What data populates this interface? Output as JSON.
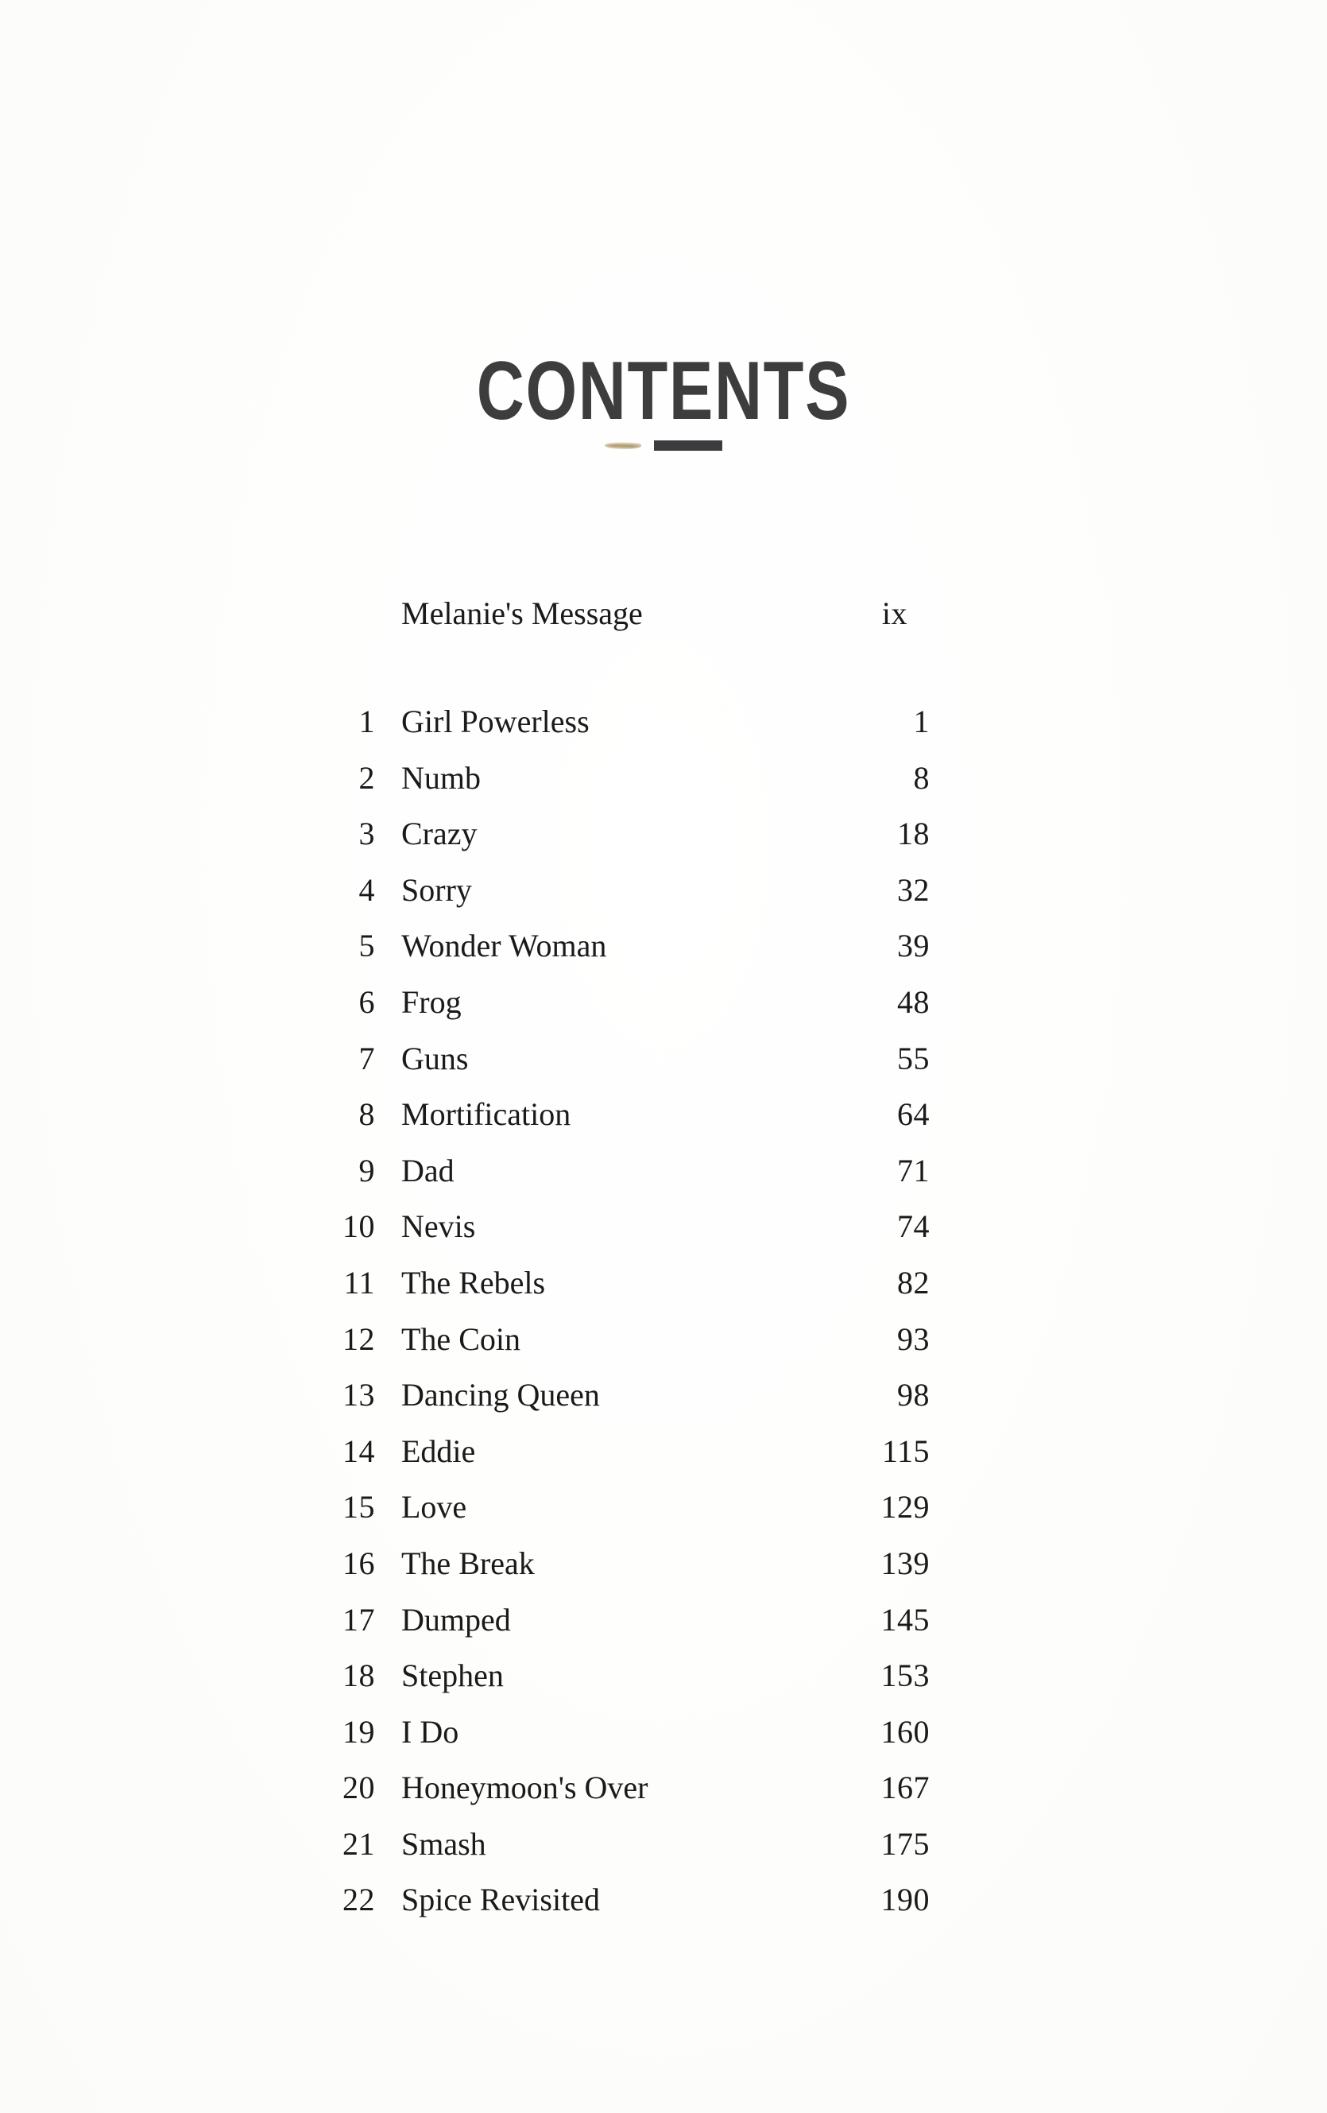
{
  "page": {
    "heading": "CONTENTS",
    "ornament": "horizontal-rule-ornament",
    "background_color": "#fdfdfd",
    "heading_color": "#3d3d3d",
    "text_color": "#1a1a1a",
    "ornament_rule_color": "#3b3c3e",
    "ornament_smudge_color": "#a88e56"
  },
  "front_matter": [
    {
      "title": "Melanie's Message",
      "page": "ix"
    }
  ],
  "chapters": [
    {
      "number": "1",
      "title": "Girl Powerless",
      "page": "1"
    },
    {
      "number": "2",
      "title": "Numb",
      "page": "8"
    },
    {
      "number": "3",
      "title": "Crazy",
      "page": "18"
    },
    {
      "number": "4",
      "title": "Sorry",
      "page": "32"
    },
    {
      "number": "5",
      "title": "Wonder Woman",
      "page": "39"
    },
    {
      "number": "6",
      "title": "Frog",
      "page": "48"
    },
    {
      "number": "7",
      "title": "Guns",
      "page": "55"
    },
    {
      "number": "8",
      "title": "Mortification",
      "page": "64"
    },
    {
      "number": "9",
      "title": "Dad",
      "page": "71"
    },
    {
      "number": "10",
      "title": "Nevis",
      "page": "74"
    },
    {
      "number": "11",
      "title": "The Rebels",
      "page": "82"
    },
    {
      "number": "12",
      "title": "The Coin",
      "page": "93"
    },
    {
      "number": "13",
      "title": "Dancing Queen",
      "page": "98"
    },
    {
      "number": "14",
      "title": "Eddie",
      "page": "115"
    },
    {
      "number": "15",
      "title": "Love",
      "page": "129"
    },
    {
      "number": "16",
      "title": "The Break",
      "page": "139"
    },
    {
      "number": "17",
      "title": "Dumped",
      "page": "145"
    },
    {
      "number": "18",
      "title": "Stephen",
      "page": "153"
    },
    {
      "number": "19",
      "title": "I Do",
      "page": "160"
    },
    {
      "number": "20",
      "title": "Honeymoon's Over",
      "page": "167"
    },
    {
      "number": "21",
      "title": "Smash",
      "page": "175"
    },
    {
      "number": "22",
      "title": "Spice Revisited",
      "page": "190"
    }
  ]
}
